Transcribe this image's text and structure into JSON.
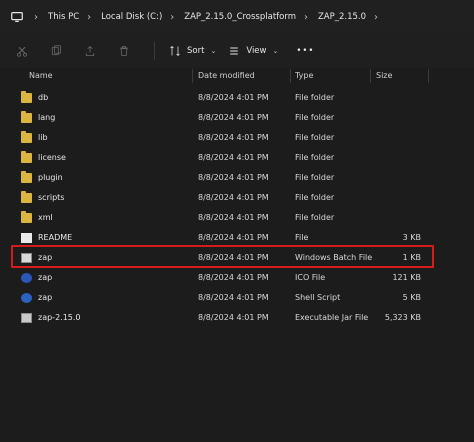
{
  "breadcrumb": {
    "items": [
      "This PC",
      "Local Disk (C:)",
      "ZAP_2.15.0_Crossplatform",
      "ZAP_2.15.0"
    ]
  },
  "toolbar": {
    "sort_label": "Sort",
    "view_label": "View",
    "more_label": "•••"
  },
  "columns": {
    "name": "Name",
    "date_modified": "Date modified",
    "type": "Type",
    "size": "Size"
  },
  "files": [
    {
      "name": "db",
      "date": "8/8/2024 4:01 PM",
      "type": "File folder",
      "size": "",
      "icon": "folder-icon"
    },
    {
      "name": "lang",
      "date": "8/8/2024 4:01 PM",
      "type": "File folder",
      "size": "",
      "icon": "folder-icon"
    },
    {
      "name": "lib",
      "date": "8/8/2024 4:01 PM",
      "type": "File folder",
      "size": "",
      "icon": "folder-icon"
    },
    {
      "name": "license",
      "date": "8/8/2024 4:01 PM",
      "type": "File folder",
      "size": "",
      "icon": "folder-icon"
    },
    {
      "name": "plugin",
      "date": "8/8/2024 4:01 PM",
      "type": "File folder",
      "size": "",
      "icon": "folder-icon"
    },
    {
      "name": "scripts",
      "date": "8/8/2024 4:01 PM",
      "type": "File folder",
      "size": "",
      "icon": "folder-icon"
    },
    {
      "name": "xml",
      "date": "8/8/2024 4:01 PM",
      "type": "File folder",
      "size": "",
      "icon": "folder-icon"
    },
    {
      "name": "README",
      "date": "8/8/2024 4:01 PM",
      "type": "File",
      "size": "3 KB",
      "icon": "document-icon"
    },
    {
      "name": "zap",
      "date": "8/8/2024 4:01 PM",
      "type": "Windows Batch File",
      "size": "1 KB",
      "icon": "batch-file-icon"
    },
    {
      "name": "zap",
      "date": "8/8/2024 4:01 PM",
      "type": "ICO File",
      "size": "121 KB",
      "icon": "ico-file-icon"
    },
    {
      "name": "zap",
      "date": "8/8/2024 4:01 PM",
      "type": "Shell Script",
      "size": "5 KB",
      "icon": "shell-script-icon"
    },
    {
      "name": "zap-2.15.0",
      "date": "8/8/2024 4:01 PM",
      "type": "Executable Jar File",
      "size": "5,323 KB",
      "icon": "jar-file-icon"
    }
  ],
  "colors": {
    "highlight": "#d51b1b",
    "folder": "#dcb441"
  }
}
